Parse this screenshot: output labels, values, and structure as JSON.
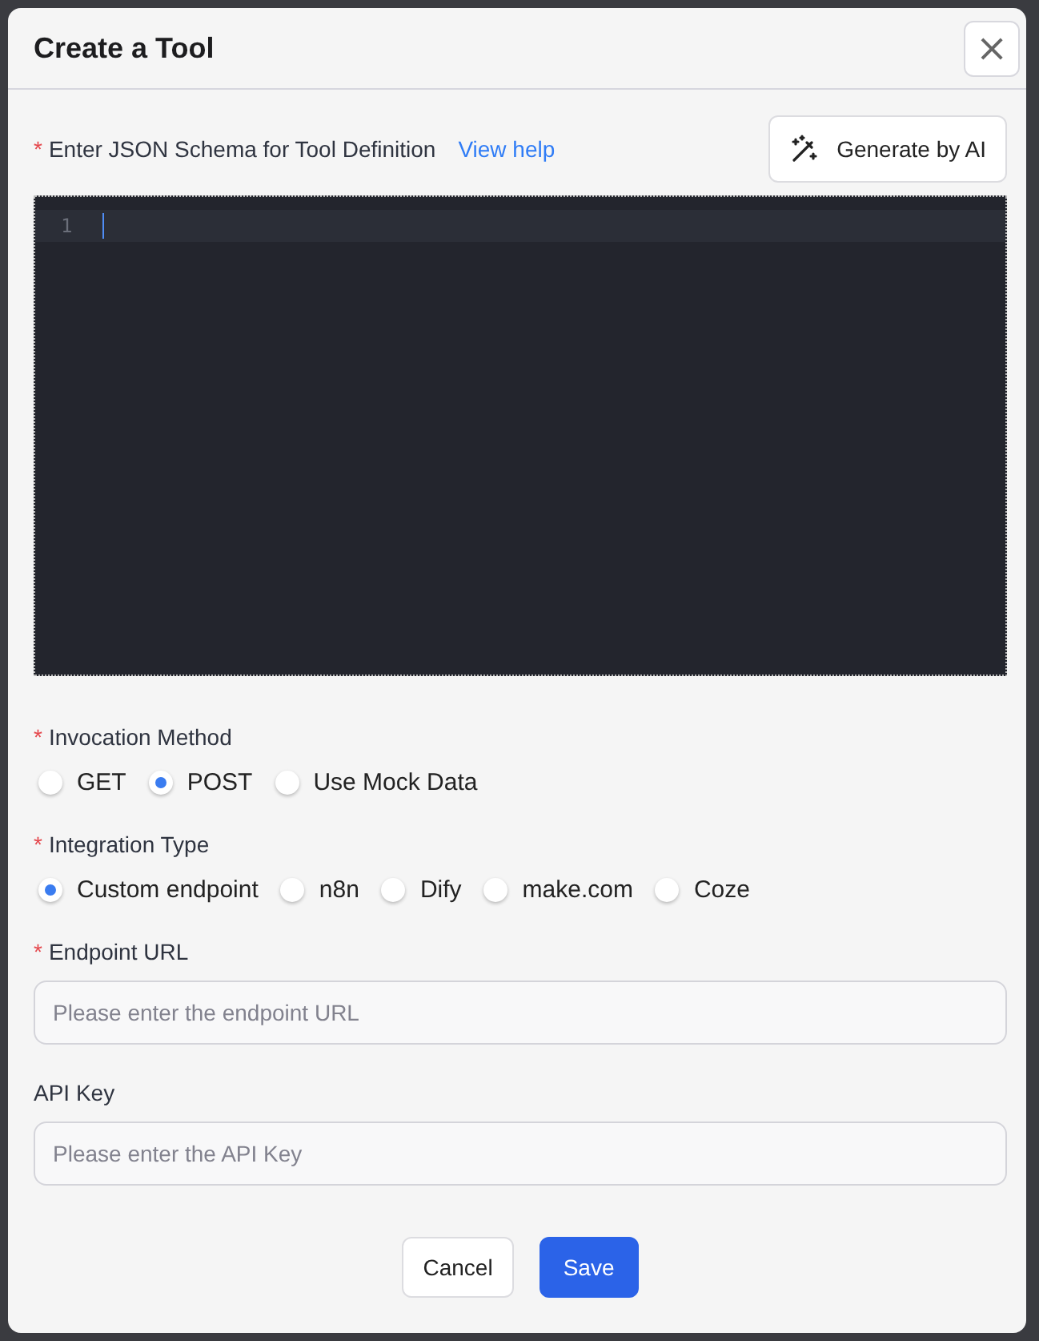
{
  "dialog": {
    "title": "Create a Tool",
    "close_icon": "×"
  },
  "schema": {
    "required_mark": "*",
    "label": "Enter JSON Schema for Tool Definition",
    "help_link": "View help",
    "generate_button": "Generate by AI",
    "editor": {
      "line_numbers": [
        "1"
      ]
    }
  },
  "groups": [
    {
      "required_mark": "*",
      "label": "Invocation Method",
      "options": [
        {
          "label": "GET",
          "selected": false
        },
        {
          "label": "POST",
          "selected": true
        },
        {
          "label": "Use Mock Data",
          "selected": false
        }
      ]
    },
    {
      "required_mark": "*",
      "label": "Integration Type",
      "options": [
        {
          "label": "Custom endpoint",
          "selected": true
        },
        {
          "label": "n8n",
          "selected": false
        },
        {
          "label": "Dify",
          "selected": false
        },
        {
          "label": "make.com",
          "selected": false
        },
        {
          "label": "Coze",
          "selected": false
        }
      ]
    }
  ],
  "fields": [
    {
      "required_mark": "*",
      "label": "Endpoint URL",
      "placeholder": "Please enter the endpoint URL"
    },
    {
      "label": "API Key",
      "placeholder": "Please enter the API Key"
    }
  ],
  "buttons": [
    {
      "label": "Cancel",
      "kind": "secondary"
    },
    {
      "label": "Save",
      "kind": "primary"
    }
  ]
}
